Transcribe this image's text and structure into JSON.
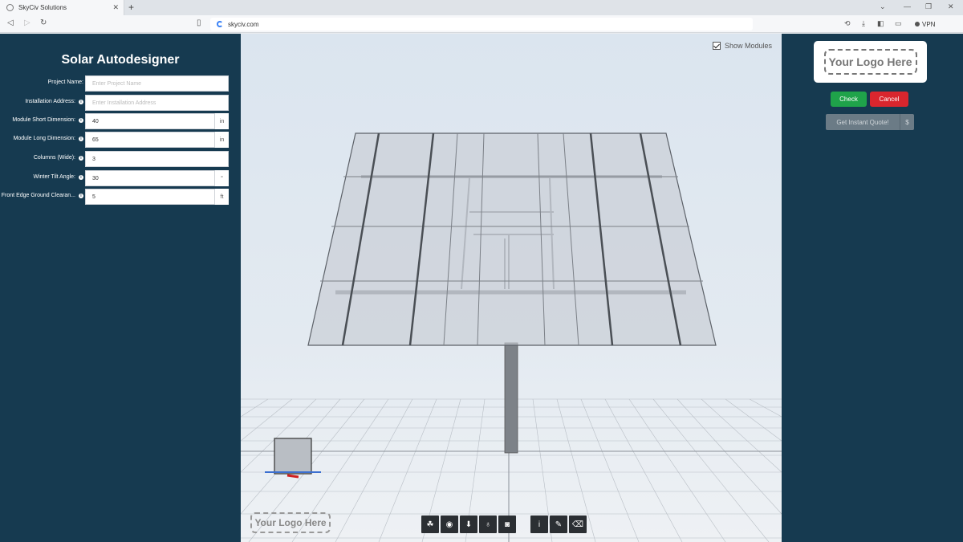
{
  "browser": {
    "tab_title": "SkyCiv Solutions",
    "new_tab": "+",
    "url": "skyciv.com",
    "vpn_label": "VPN"
  },
  "left_panel": {
    "title": "Solar Autodesigner",
    "fields": [
      {
        "label": "Project Name:",
        "info": false,
        "value": "",
        "placeholder": "Enter Project Name",
        "unit": ""
      },
      {
        "label": "Installation Address:",
        "info": true,
        "value": "",
        "placeholder": "Enter Installation Address",
        "unit": ""
      },
      {
        "label": "Module Short Dimension:",
        "info": true,
        "value": "40",
        "placeholder": "",
        "unit": "in"
      },
      {
        "label": "Module Long Dimension:",
        "info": true,
        "value": "65",
        "placeholder": "",
        "unit": "in"
      },
      {
        "label": "Columns (Wide):",
        "info": true,
        "value": "3",
        "placeholder": "",
        "unit": ""
      },
      {
        "label": "Winter Tilt Angle:",
        "info": true,
        "value": "30",
        "placeholder": "",
        "unit": "°"
      },
      {
        "label": "Front Edge Ground Clearan...",
        "info": true,
        "value": "5",
        "placeholder": "",
        "unit": "ft"
      }
    ]
  },
  "viewer": {
    "show_modules_label": "Show Modules",
    "show_modules_checked": true,
    "logo_text": "Your Logo Here",
    "toolbar": [
      "layers-icon",
      "eye-icon",
      "download-icon",
      "lightbulb-icon",
      "camera-icon",
      "info-icon",
      "pencil-icon",
      "eraser-icon"
    ]
  },
  "right_panel": {
    "logo_text": "Your Logo Here",
    "check_label": "Check",
    "cancel_label": "Cancel",
    "quote_label": "Get Instant Quote!",
    "quote_suffix": "$"
  },
  "colors": {
    "panel_bg": "#163a50",
    "check": "#1fa34a",
    "cancel": "#d9262e"
  }
}
